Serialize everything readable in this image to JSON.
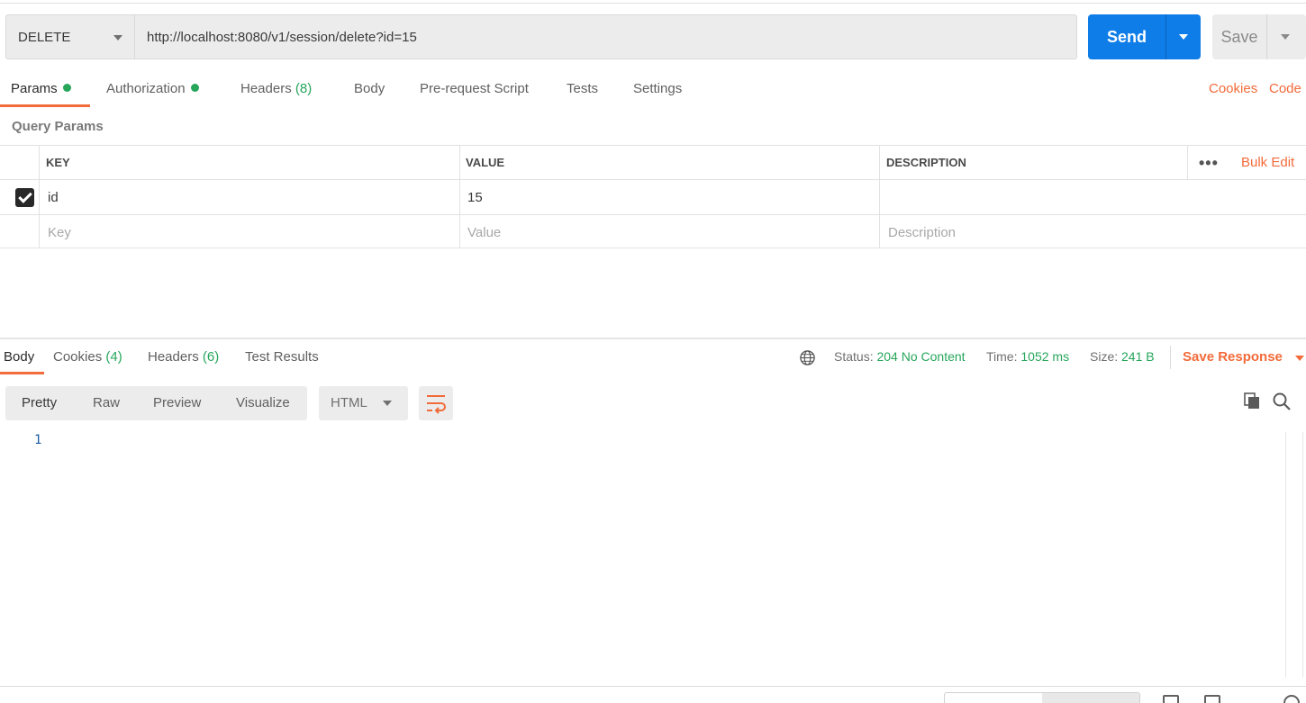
{
  "request": {
    "method": "DELETE",
    "url": "http://localhost:8080/v1/session/delete?id=15",
    "send_label": "Send",
    "save_label": "Save"
  },
  "request_tabs": {
    "params": "Params",
    "authorization": "Authorization",
    "headers": "Headers",
    "headers_count": "(8)",
    "body": "Body",
    "prerequest": "Pre-request Script",
    "tests": "Tests",
    "settings": "Settings",
    "cookies_link": "Cookies",
    "code_link": "Code"
  },
  "query_params": {
    "title": "Query Params",
    "columns": {
      "key": "KEY",
      "value": "VALUE",
      "description": "DESCRIPTION"
    },
    "bulk_edit": "Bulk Edit",
    "rows": [
      {
        "key": "id",
        "value": "15",
        "description": "",
        "checked": true
      }
    ],
    "placeholders": {
      "key": "Key",
      "value": "Value",
      "description": "Description"
    }
  },
  "response_tabs": {
    "body": "Body",
    "cookies": "Cookies",
    "cookies_count": "(4)",
    "headers": "Headers",
    "headers_count": "(6)",
    "test_results": "Test Results"
  },
  "response_meta": {
    "status_label": "Status:",
    "status_value": "204 No Content",
    "time_label": "Time:",
    "time_value": "1052 ms",
    "size_label": "Size:",
    "size_value": "241 B",
    "save_response": "Save Response"
  },
  "viewer": {
    "formats": [
      "Pretty",
      "Raw",
      "Preview",
      "Visualize"
    ],
    "active_format": "Pretty",
    "language": "HTML",
    "line_numbers": [
      "1"
    ]
  },
  "colors": {
    "accent": "#f26b3a",
    "send_blue": "#0f7de8",
    "success_green": "#26a65b"
  },
  "icons": [
    "chevron-down-icon",
    "globe-icon",
    "wrap-lines-icon",
    "copy-icon",
    "search-icon",
    "more-horizontal-icon",
    "checkbox-checked-icon"
  ]
}
